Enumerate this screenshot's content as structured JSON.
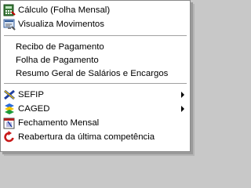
{
  "menu": {
    "items": [
      {
        "label": "Cálculo (Folha Mensal)",
        "icon": "calculation-sheet-icon"
      },
      {
        "label": "Visualiza Movimentos",
        "icon": "view-movements-icon"
      },
      {
        "label": "Recibo de Pagamento"
      },
      {
        "label": "Folha de Pagamento"
      },
      {
        "label": "Resumo Geral de Salários e Encargos"
      },
      {
        "label": "SEFIP",
        "icon": "sefip-icon",
        "submenu": true
      },
      {
        "label": "CAGED",
        "icon": "caged-icon",
        "submenu": true
      },
      {
        "label": "Fechamento Mensal",
        "icon": "monthly-closing-icon"
      },
      {
        "label": "Reabertura da última competência",
        "icon": "reopen-icon"
      }
    ]
  }
}
